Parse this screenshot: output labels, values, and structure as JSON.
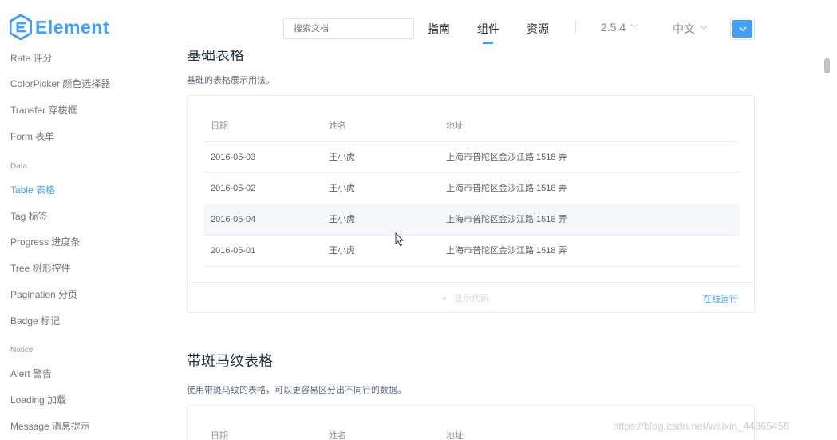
{
  "header": {
    "logo_text": "Element",
    "search_placeholder": "搜索文档",
    "nav": [
      {
        "label": "指南"
      },
      {
        "label": "组件",
        "active": true
      },
      {
        "label": "资源"
      }
    ],
    "version": "2.5.4",
    "language": "中文"
  },
  "sidebar": {
    "items_top": [
      {
        "label": "Rate 评分"
      },
      {
        "label": "ColorPicker 颜色选择器"
      },
      {
        "label": "Transfer 穿梭框"
      },
      {
        "label": "Form 表单"
      }
    ],
    "group_data": "Data",
    "items_data": [
      {
        "label": "Table 表格",
        "active": true
      },
      {
        "label": "Tag 标签"
      },
      {
        "label": "Progress 进度条"
      },
      {
        "label": "Tree 树形控件"
      },
      {
        "label": "Pagination 分页"
      },
      {
        "label": "Badge 标记"
      }
    ],
    "group_notice": "Notice",
    "items_notice": [
      {
        "label": "Alert 警告"
      },
      {
        "label": "Loading 加载"
      },
      {
        "label": "Message 消息提示"
      }
    ]
  },
  "basic_table": {
    "title": "基础表格",
    "description": "基础的表格展示用法。",
    "columns": [
      "日期",
      "姓名",
      "地址"
    ],
    "rows": [
      [
        "2016-05-03",
        "王小虎",
        "上海市普陀区金沙江路 1518 弄"
      ],
      [
        "2016-05-02",
        "王小虎",
        "上海市普陀区金沙江路 1518 弄"
      ],
      [
        "2016-05-04",
        "王小虎",
        "上海市普陀区金沙江路 1518 弄"
      ],
      [
        "2016-05-01",
        "王小虎",
        "上海市普陀区金沙江路 1518 弄"
      ]
    ],
    "show_code": "显示代码",
    "run_online": "在线运行"
  },
  "striped_table": {
    "title": "带斑马纹表格",
    "description": "使用带斑马纹的表格，可以更容易区分出不同行的数据。",
    "columns": [
      "日期",
      "姓名",
      "地址"
    ]
  },
  "watermark": "https://blog.csdn.net/weixin_44865458",
  "colors": {
    "accent": "#409eff",
    "hover_row": "#f5f7fa"
  }
}
